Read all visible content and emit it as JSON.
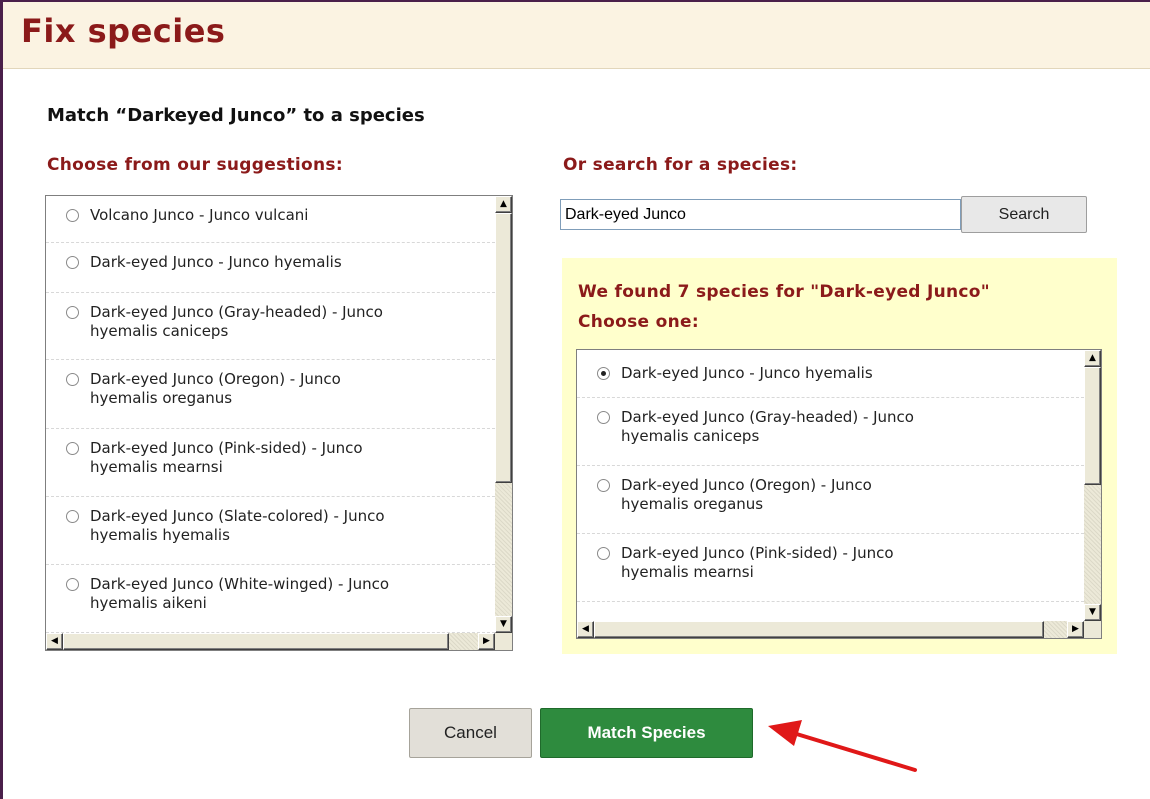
{
  "header": {
    "title": "Fix species"
  },
  "match_title": "Match “Darkeyed Junco” to a species",
  "suggestions": {
    "heading": "Choose from our suggestions:",
    "items": [
      {
        "line1": "Volcano Junco - Junco vulcani",
        "line2": ""
      },
      {
        "line1": "Dark-eyed Junco - Junco hyemalis",
        "line2": ""
      },
      {
        "line1": "Dark-eyed Junco (Gray-headed) - Junco",
        "line2": "hyemalis caniceps"
      },
      {
        "line1": "Dark-eyed Junco (Oregon) - Junco",
        "line2": "hyemalis oreganus"
      },
      {
        "line1": "Dark-eyed Junco (Pink-sided) - Junco",
        "line2": "hyemalis mearnsi"
      },
      {
        "line1": "Dark-eyed Junco (Slate-colored) - Junco",
        "line2": "hyemalis hyemalis"
      },
      {
        "line1": "Dark-eyed Junco (White-winged) - Junco",
        "line2": "hyemalis aikeni"
      }
    ]
  },
  "search": {
    "heading": "Or search for a species:",
    "value": "Dark-eyed Junco",
    "button_label": "Search"
  },
  "results": {
    "line1": "We found 7 species for \"Dark-eyed Junco\"",
    "line2": "Choose one:",
    "items": [
      {
        "line1": "Dark-eyed Junco - Junco hyemalis",
        "line2": "",
        "checked": true
      },
      {
        "line1": "Dark-eyed Junco (Gray-headed) - Junco",
        "line2": "hyemalis caniceps",
        "checked": false
      },
      {
        "line1": "Dark-eyed Junco (Oregon) - Junco",
        "line2": "hyemalis oreganus",
        "checked": false
      },
      {
        "line1": "Dark-eyed Junco (Pink-sided) - Junco",
        "line2": "hyemalis mearnsi",
        "checked": false
      }
    ]
  },
  "actions": {
    "cancel_label": "Cancel",
    "match_label": "Match Species"
  },
  "colors": {
    "title": "#8b1a1a",
    "header_bg": "#fbf3e2",
    "results_bg": "#ffffcc",
    "match_button": "#2e8b3e",
    "annotation_arrow": "#e01818"
  }
}
